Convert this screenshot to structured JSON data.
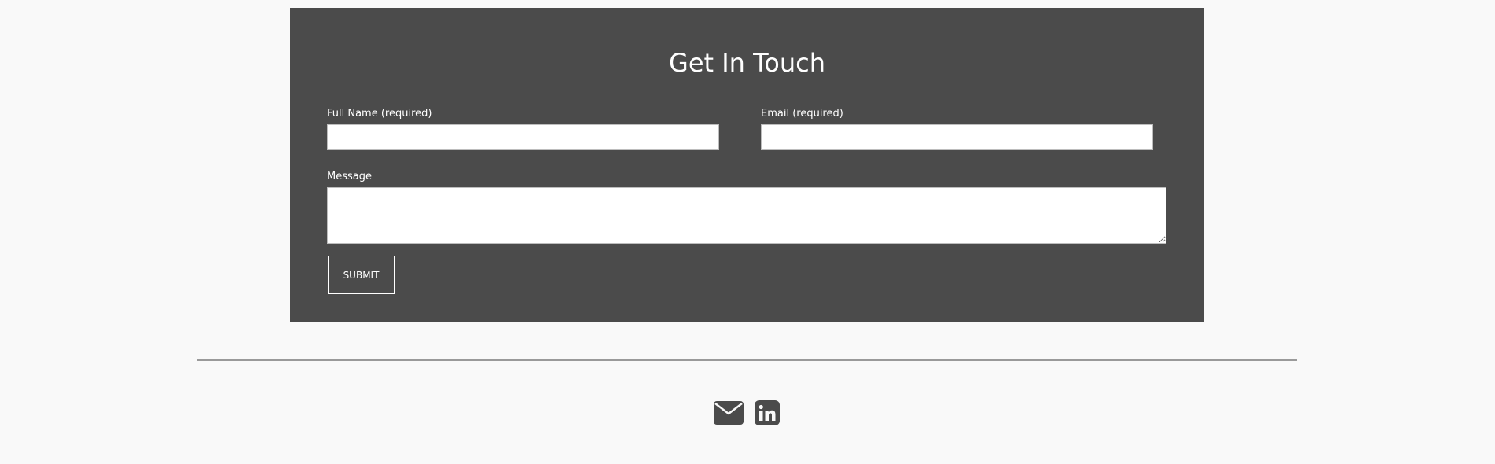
{
  "contact": {
    "title": "Get In Touch",
    "full_name": {
      "label": "Full Name (required)",
      "value": "",
      "placeholder": ""
    },
    "email": {
      "label": "Email (required)",
      "value": "",
      "placeholder": ""
    },
    "message": {
      "label": "Message",
      "value": "",
      "placeholder": ""
    },
    "submit_label": "SUBMIT"
  },
  "footer": {
    "social": [
      {
        "icon": "envelope-icon"
      },
      {
        "icon": "linkedin-icon"
      }
    ]
  },
  "colors": {
    "page_background": "#f9f9f9",
    "panel_background": "#4b4b4b",
    "icon": "#4b4b4b",
    "divider": "#9a9a9a",
    "text_on_panel": "#ffffff"
  }
}
